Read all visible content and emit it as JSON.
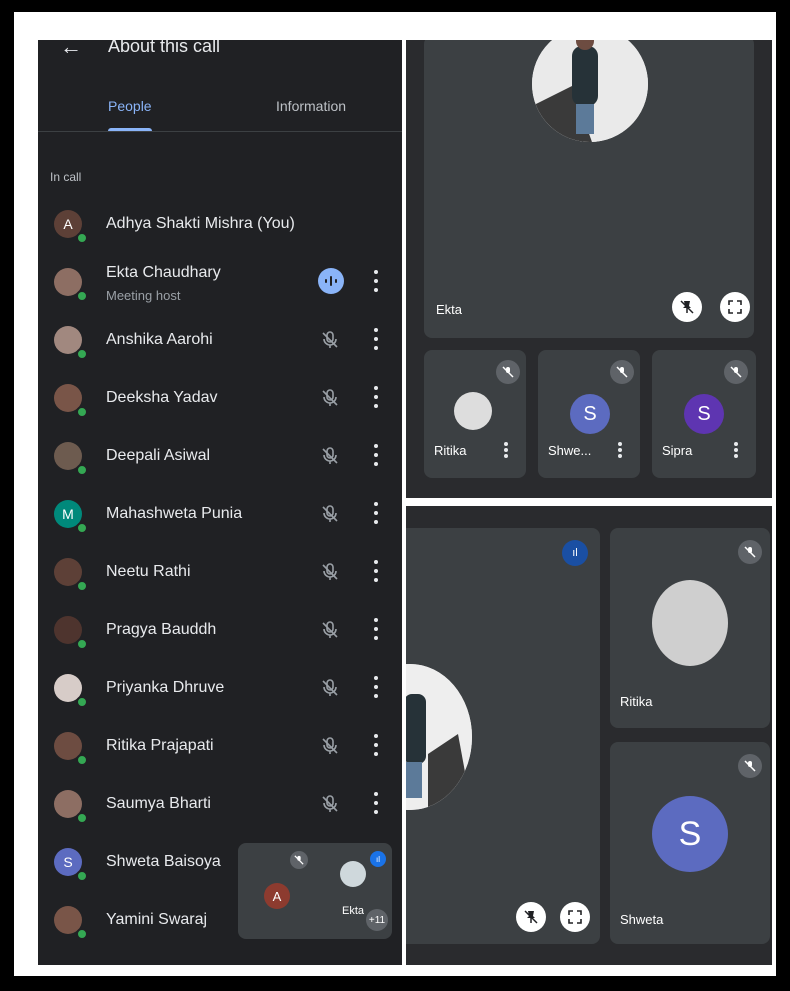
{
  "header": {
    "title": "About this call"
  },
  "tabs": {
    "people": "People",
    "information": "Information"
  },
  "section_label": "In call",
  "participants": [
    {
      "name": "Adhya Shakti Mishra (You)",
      "avatar_letter": "A",
      "avatar_color": "#5d4037"
    },
    {
      "name": "Ekta Chaudhary",
      "subtitle": "Meeting host"
    },
    {
      "name": "Anshika Aarohi"
    },
    {
      "name": "Deeksha Yadav"
    },
    {
      "name": "Deepali Asiwal"
    },
    {
      "name": "Mahashweta Punia",
      "avatar_letter": "M",
      "avatar_color": "#00897b"
    },
    {
      "name": "Neetu Rathi"
    },
    {
      "name": "Pragya Bauddh"
    },
    {
      "name": "Priyanka Dhruve"
    },
    {
      "name": "Ritika Prajapati"
    },
    {
      "name": "Saumya Bharti"
    },
    {
      "name": "Shweta Baisoya",
      "avatar_letter": "S",
      "avatar_color": "#5c6bc0"
    },
    {
      "name": "Yamini Swaraj"
    }
  ],
  "grid_top": {
    "main_tile": {
      "name": "Ekta"
    },
    "small_tiles": [
      {
        "name": "Ritika"
      },
      {
        "name": "Shwe...",
        "avatar_letter": "S",
        "avatar_color": "#5c6bc0"
      },
      {
        "name": "Sipra",
        "avatar_letter": "S",
        "avatar_color": "#5e35b1"
      }
    ]
  },
  "grid_bottom": {
    "tiles": [
      {
        "name": "Ritika"
      },
      {
        "name": "Shweta",
        "avatar_letter": "S",
        "avatar_color": "#5c6bc0"
      }
    ]
  },
  "floating": {
    "self_letter": "A",
    "other_name": "Ekta",
    "more_count": "+11"
  },
  "colors": {
    "panel_bg": "#202124",
    "accent": "#8ab4f8",
    "tile_bg": "#3c4043",
    "online": "#34a853"
  }
}
